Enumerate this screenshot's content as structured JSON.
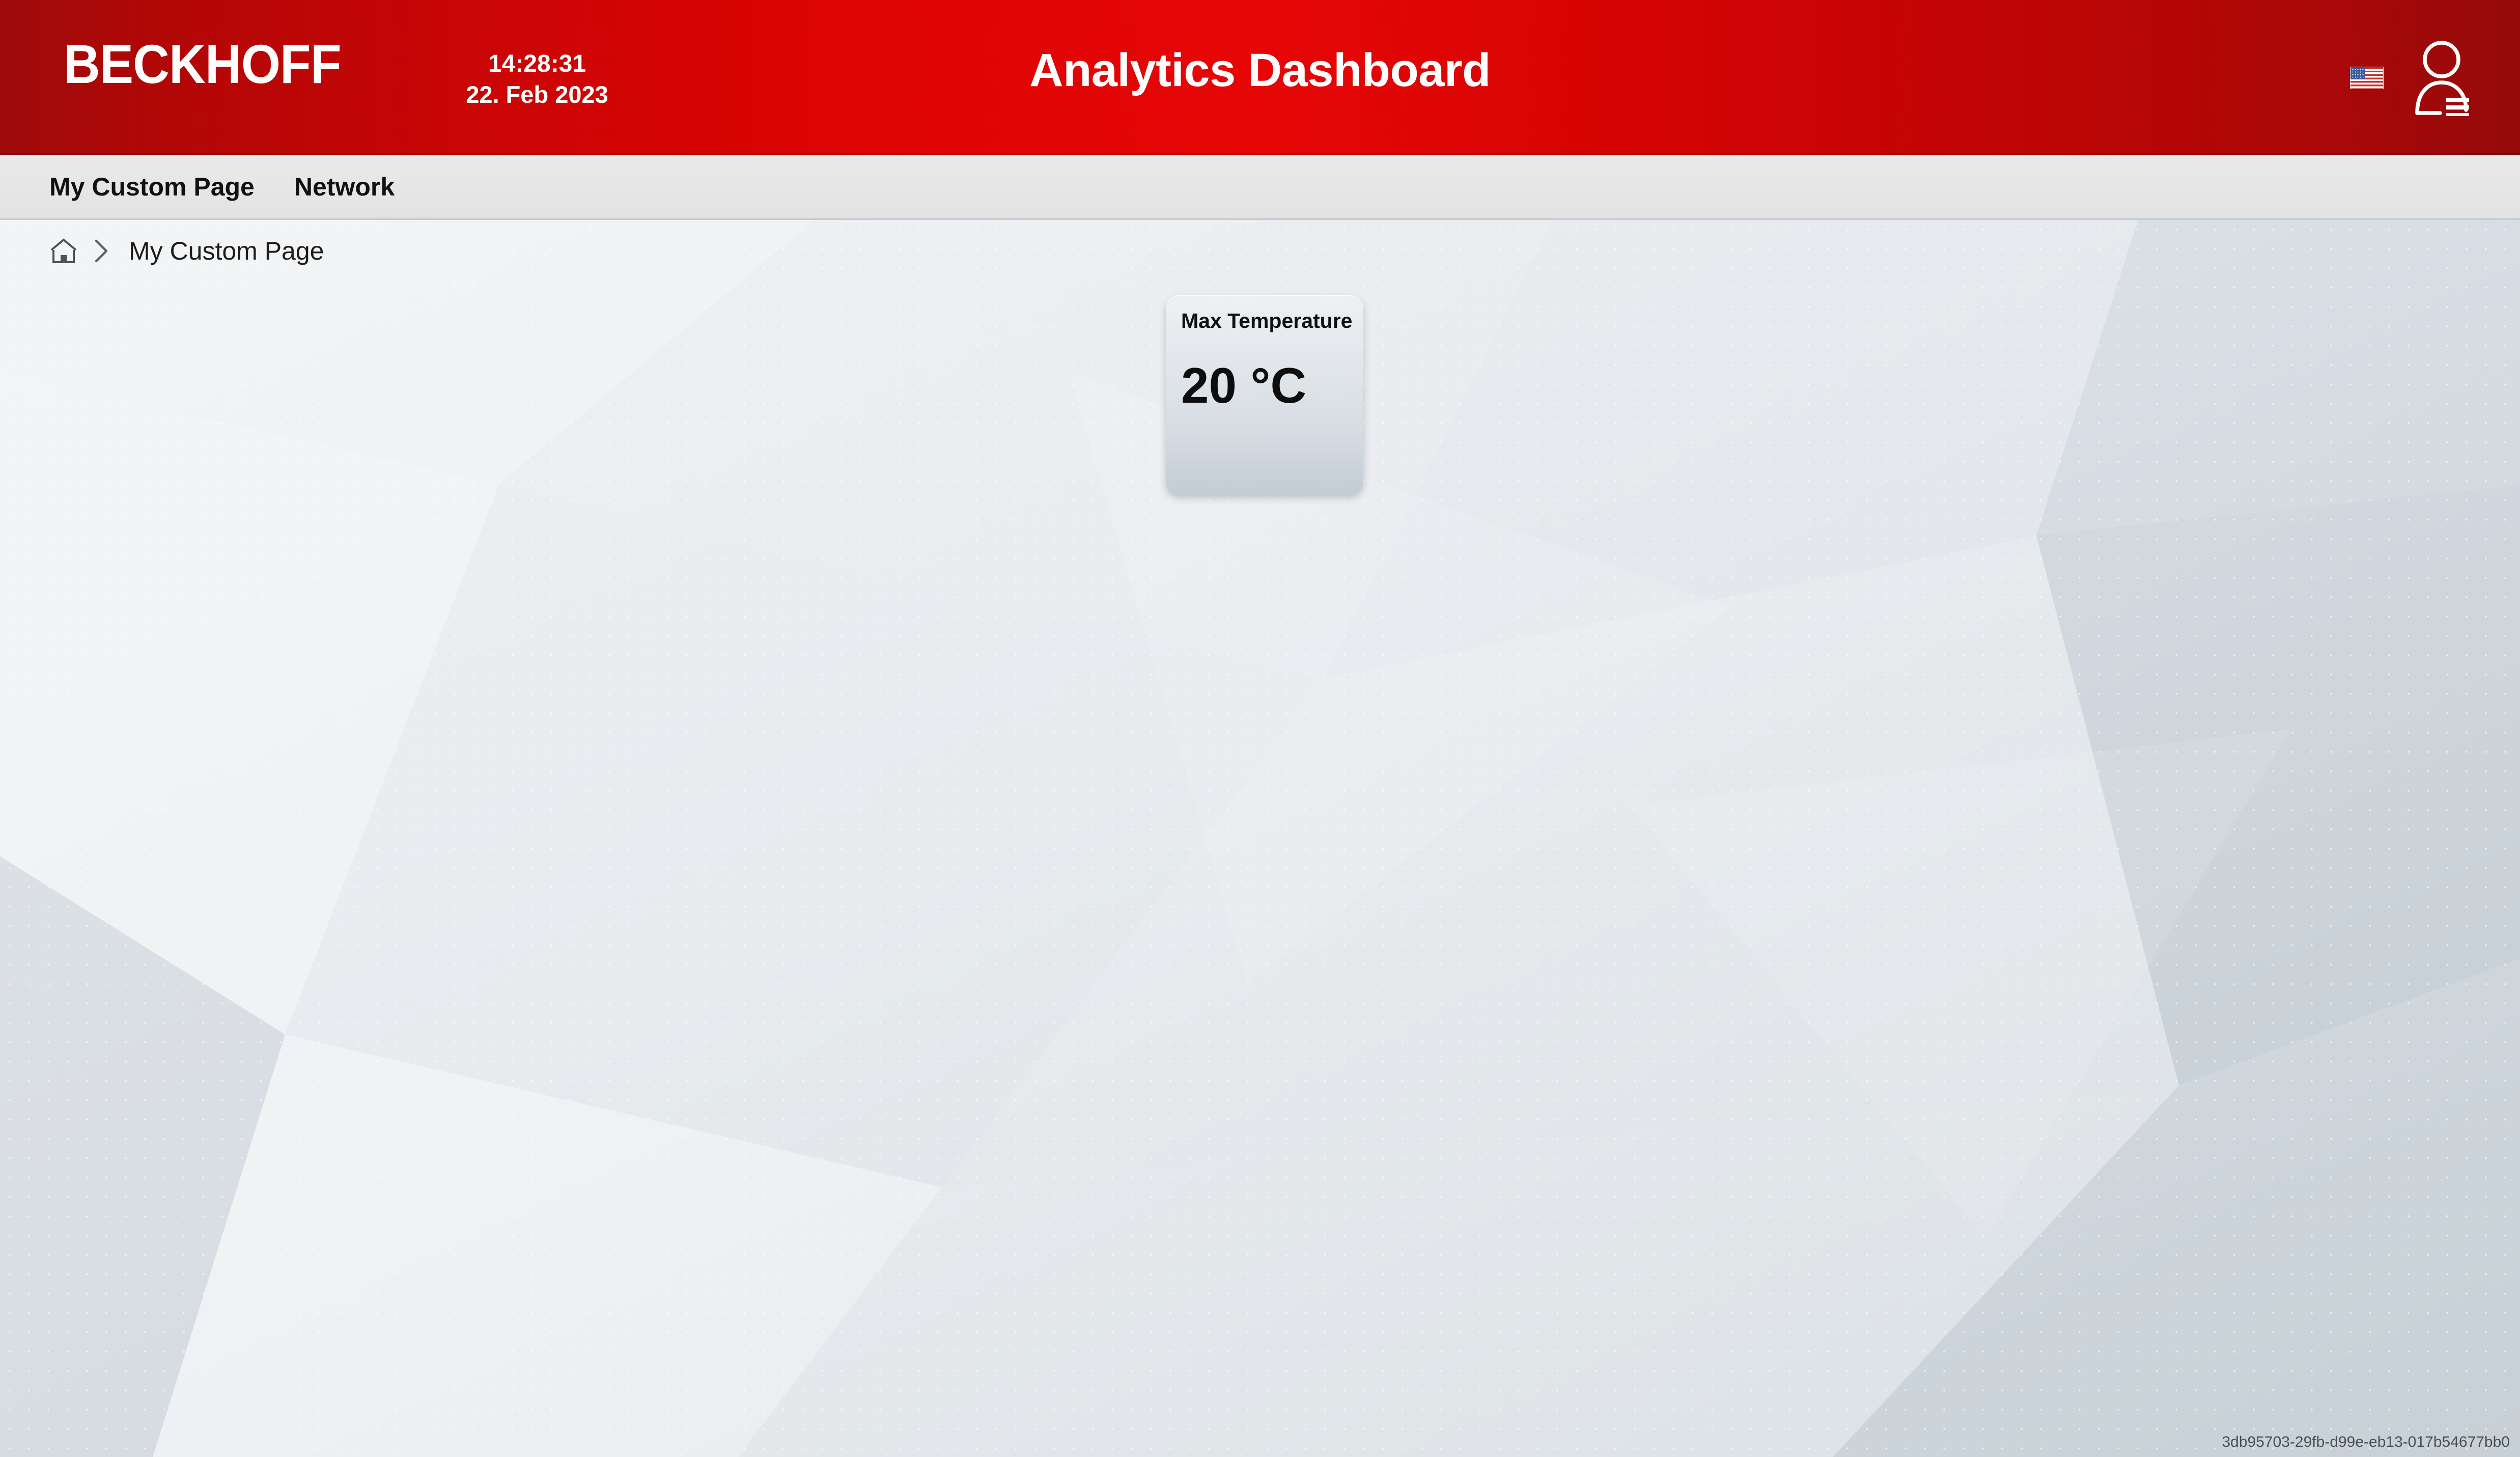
{
  "header": {
    "logo_text": "BECKHOFF",
    "time": "14:28:31",
    "date": "22. Feb 2023",
    "title": "Analytics Dashboard",
    "language_flag": "us-flag-icon",
    "user_menu_icon": "user-account-icon",
    "background_color": "#de0404"
  },
  "navbar": {
    "items": [
      {
        "label": "My Custom Page"
      },
      {
        "label": "Network"
      }
    ]
  },
  "breadcrumb": {
    "home_icon": "home-icon",
    "separator_icon": "chevron-right-icon",
    "current": "My Custom Page"
  },
  "widgets": [
    {
      "title": "Max Temperature",
      "value": "20 °C"
    }
  ],
  "footer": {
    "guid": "3db95703-29fb-d99e-eb13-017b54677bb0"
  }
}
